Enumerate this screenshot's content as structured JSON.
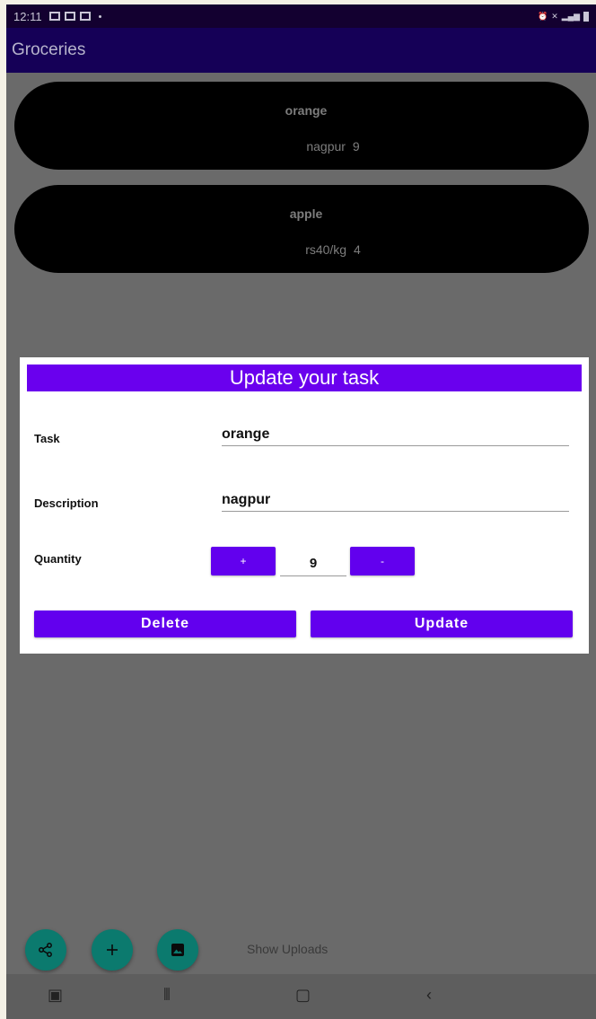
{
  "status_bar": {
    "time": "12:11"
  },
  "app": {
    "title": "Groceries"
  },
  "items": [
    {
      "name": "orange",
      "description": "nagpur",
      "quantity": "9"
    },
    {
      "name": "apple",
      "description": "rs40/kg",
      "quantity": "4"
    }
  ],
  "dialog": {
    "title": "Update your task",
    "task_label": "Task",
    "task_value": "orange",
    "description_label": "Description",
    "description_value": "nagpur",
    "quantity_label": "Quantity",
    "quantity_value": "9",
    "plus_label": "+",
    "minus_label": "-",
    "delete_label": "Delete",
    "update_label": "Update"
  },
  "bottom": {
    "show_uploads": "Show Uploads"
  },
  "icons": {
    "share": "share-icon",
    "add": "plus-icon",
    "image": "image-icon"
  },
  "colors": {
    "accent": "#6200ee",
    "app_bar": "#150057",
    "fab": "#0b7a6e",
    "card": "#000000"
  }
}
